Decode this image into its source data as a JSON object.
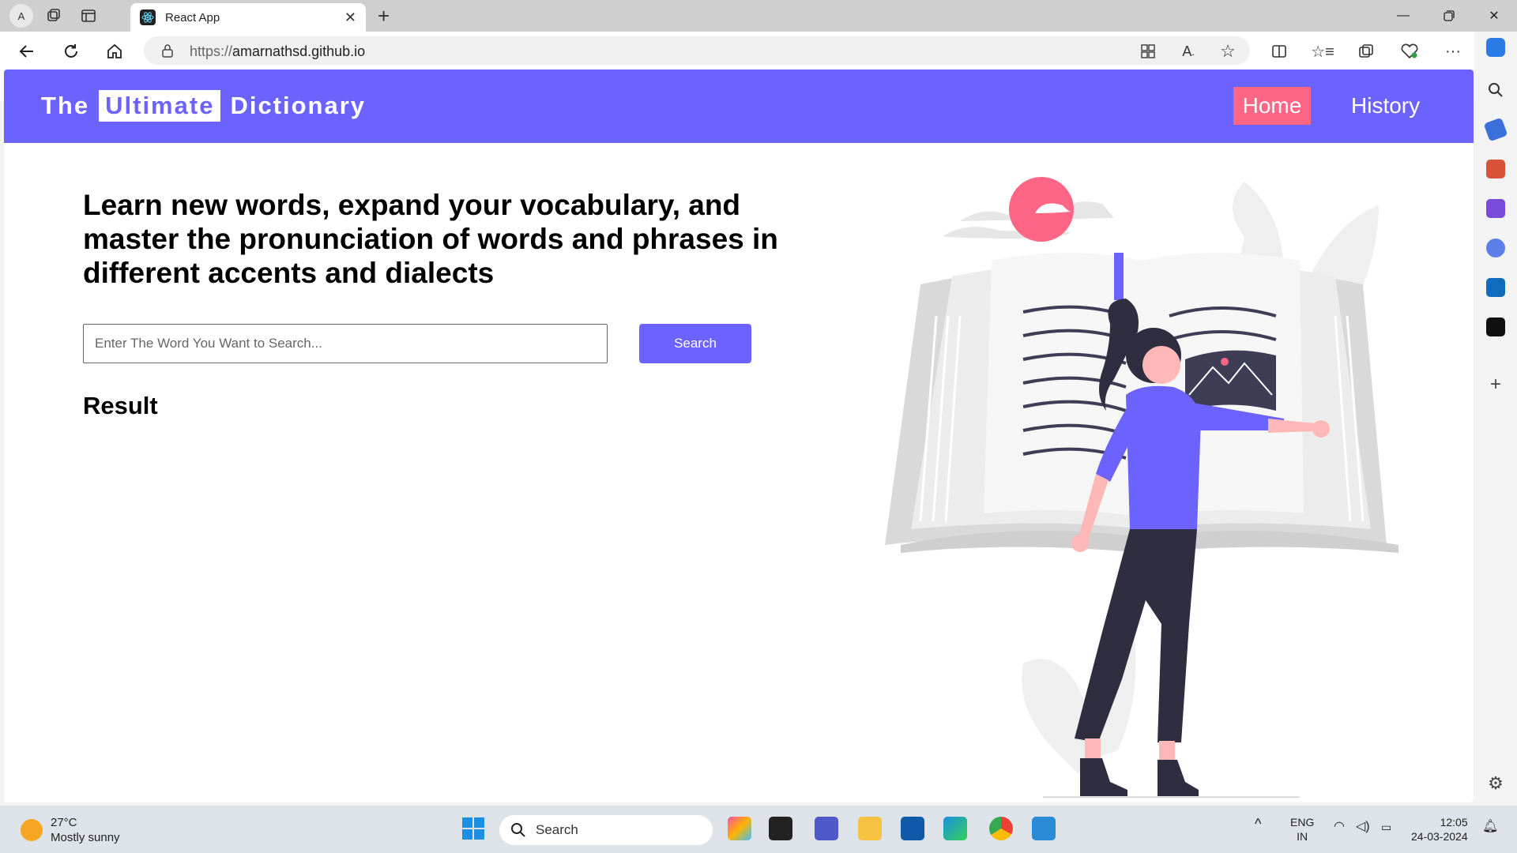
{
  "browser": {
    "profile_initial": "A",
    "tab_title": "React App",
    "url_protocol": "https://",
    "url_host": "amarnathsd.github.io"
  },
  "page": {
    "brand": {
      "pre": "The",
      "highlight": "Ultimate",
      "post": "Dictionary"
    },
    "nav": {
      "home": "Home",
      "history": "History"
    },
    "headline": "Learn new words, expand your vocabulary, and master the pronunciation of words and phrases in different accents and dialects",
    "search": {
      "placeholder": "Enter The Word You Want to Search...",
      "button": "Search"
    },
    "result_heading": "Result"
  },
  "colors": {
    "primary": "#6c63ff",
    "accent": "#ff6584"
  },
  "taskbar": {
    "weather_temp": "27°C",
    "weather_desc": "Mostly sunny",
    "search_label": "Search",
    "lang_top": "ENG",
    "lang_bottom": "IN",
    "time": "12:05",
    "date": "24-03-2024"
  }
}
